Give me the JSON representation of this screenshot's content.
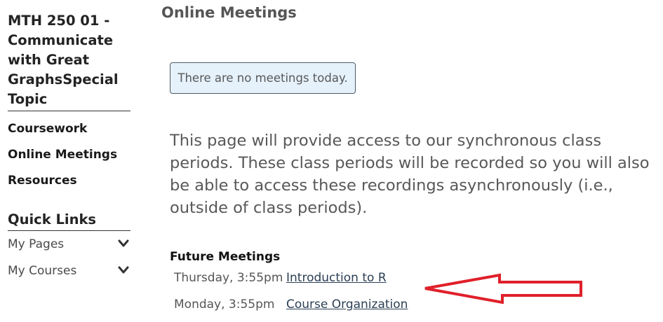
{
  "sidebar": {
    "course_title": "MTH 250 01 - Communicate with Great GraphsSpecial Topic",
    "nav": [
      {
        "label": "Coursework"
      },
      {
        "label": "Online Meetings"
      },
      {
        "label": "Resources"
      }
    ],
    "quick_links_title": "Quick Links",
    "quick_links": [
      {
        "label": "My Pages",
        "icon": "chevron-down-icon"
      },
      {
        "label": "My Courses",
        "icon": "chevron-down-icon"
      }
    ]
  },
  "main": {
    "title": "Online Meetings",
    "alert": "There are no meetings today.",
    "description": "This page will provide access to our synchronous class periods. These class periods will be recorded so you will also be able to access these recordings asynchronously (i.e., outside of class periods).",
    "future_title": "Future Meetings",
    "meetings": [
      {
        "time": "Thursday, 3:55pm",
        "title": "Introduction to R"
      },
      {
        "time": "Monday, 3:55pm",
        "title": "Course Organization"
      }
    ]
  },
  "annotation": {
    "icon": "red-arrow-icon",
    "color": "#e0202a"
  }
}
